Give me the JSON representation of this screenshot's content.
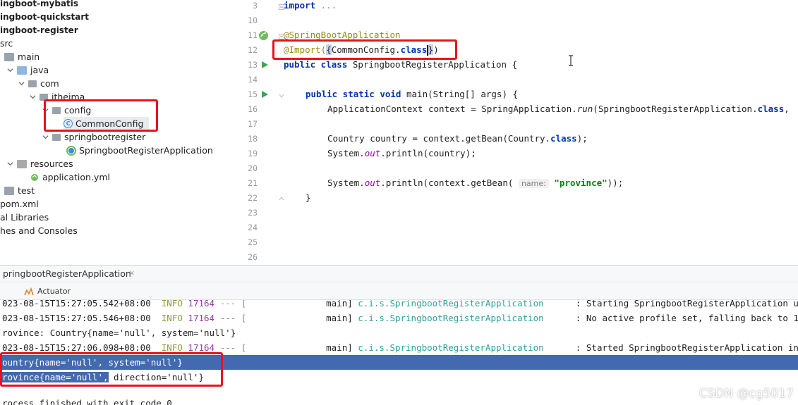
{
  "project_tree": {
    "items": [
      {
        "label": "ingboot-mybatis"
      },
      {
        "label": "ingboot-quickstart"
      },
      {
        "label": "ingboot-register"
      },
      {
        "label": "src"
      },
      {
        "label": "main"
      },
      {
        "label": "java"
      },
      {
        "label": "com"
      },
      {
        "label": "itheima"
      },
      {
        "label": "config"
      },
      {
        "label": "CommonConfig"
      },
      {
        "label": "springbootregister"
      },
      {
        "label": "SpringbootRegisterApplication"
      },
      {
        "label": "resources"
      },
      {
        "label": "application.yml"
      },
      {
        "label": "test"
      },
      {
        "label": "pom.xml"
      },
      {
        "label": "al Libraries"
      },
      {
        "label": "hes and Consoles"
      }
    ]
  },
  "editor": {
    "line_numbers": [
      "3",
      "10",
      "11",
      "12",
      "13",
      "14",
      "15",
      "16",
      "17",
      "18",
      "19",
      "20",
      "21",
      "22",
      "23",
      "24",
      "25",
      "26"
    ],
    "lines": {
      "l3_kw": "import",
      "l3_rest": " ...",
      "l11": "@SpringBootApplication",
      "l12_ann": "@Import(",
      "l12_brace_open": "{",
      "l12_cls": "CommonConfig.",
      "l12_kw": "class",
      "l12_brace_close": "}",
      "l12_close": ")",
      "l13_kw": "public class",
      "l13_rest": " SpringbootRegisterApplication {",
      "l15_kw": "public static void",
      "l15_rest": " main(String[] args) {",
      "l16_a": "ApplicationContext context = SpringApplication.",
      "l16_run": "run",
      "l16_b": "(SpringbootRegisterApplication.",
      "l16_kw": "class",
      "l16_c": ",",
      "l18_a": "Country country = context.getBean(Country.",
      "l18_kw": "class",
      "l18_b": ");",
      "l19_a": "System.",
      "l19_out": "out",
      "l19_b": ".println(country);",
      "l21_a": "System.",
      "l21_out": "out",
      "l21_b": ".println(context.getBean(",
      "l21_hint": "name:",
      "l21_str": "\"province\"",
      "l21_c": "));",
      "l22": "}"
    }
  },
  "run_panel": {
    "tab_title": "pringbootRegisterApplication",
    "tab_close": "×",
    "actuator_label": "Actuator",
    "logs": [
      {
        "ts": "023-08-15T15:27:05.542+08:00",
        "level": "INFO",
        "pid": "17164",
        "sep": "--- [",
        "thread": "main]",
        "logger": "c.i.s.SpringbootRegisterApplication",
        "msg": ": Starting SpringbootRegisterApplication us"
      },
      {
        "ts": "023-08-15T15:27:05.546+08:00",
        "level": "INFO",
        "pid": "17164",
        "sep": "--- [",
        "thread": "main]",
        "logger": "c.i.s.SpringbootRegisterApplication",
        "msg": ": No active profile set, falling back to 1"
      },
      {
        "plain": "rovince: Country{name='null', system='null'}"
      },
      {
        "ts": "023-08-15T15:27:06.098+08:00",
        "level": "INFO",
        "pid": "17164",
        "sep": "--- [",
        "thread": "main]",
        "logger": "c.i.s.SpringbootRegisterApplication",
        "msg": ": Started SpringbootRegisterApplication in"
      },
      {
        "plain": "ountry{name='null', system='null'}"
      },
      {
        "plain_sel": "rovince{name='null',",
        "plain_rest": " direction='null'}"
      },
      {
        "plain": "rocess finished with exit code 0"
      }
    ]
  },
  "watermark": "CSDN @cg5017",
  "colors": {
    "highlight_box": "#e8131c",
    "selection": "#4369b1",
    "keyword": "#0033b3",
    "annotation": "#9e880d",
    "string": "#067d17"
  }
}
